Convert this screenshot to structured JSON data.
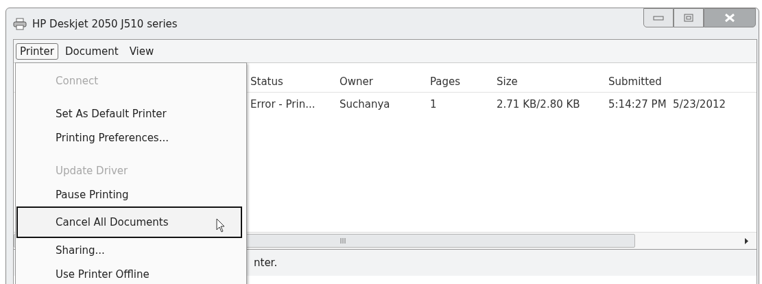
{
  "window": {
    "title": "HP Deskjet 2050 J510 series"
  },
  "menu_bar": [
    {
      "label": "Printer",
      "selected": true
    },
    {
      "label": "Document",
      "selected": false
    },
    {
      "label": "View",
      "selected": false
    }
  ],
  "table": {
    "columns": [
      "Status",
      "Owner",
      "Pages",
      "Size",
      "Submitted"
    ],
    "rows": [
      [
        "Error - Prin...",
        "Suchanya",
        "1",
        "2.71 KB/2.80 KB",
        "5:14:27 PM  5/23/2012"
      ]
    ]
  },
  "menu": {
    "groups": [
      [
        {
          "label": "Connect",
          "disabled": true,
          "selected": false
        }
      ],
      [
        {
          "label": "Set As Default Printer",
          "disabled": false,
          "selected": false
        },
        {
          "label": "Printing Preferences...",
          "disabled": false,
          "selected": false
        }
      ],
      [
        {
          "label": "Update Driver",
          "disabled": true,
          "selected": false
        },
        {
          "label": "Pause Printing",
          "disabled": false,
          "selected": false
        },
        {
          "label": "Cancel All Documents",
          "disabled": false,
          "selected": true
        },
        {
          "label": "Sharing...",
          "disabled": false,
          "selected": false
        },
        {
          "label": "Use Printer Offline",
          "disabled": false,
          "selected": false
        }
      ]
    ]
  },
  "status_bar": {
    "text": "nter."
  }
}
